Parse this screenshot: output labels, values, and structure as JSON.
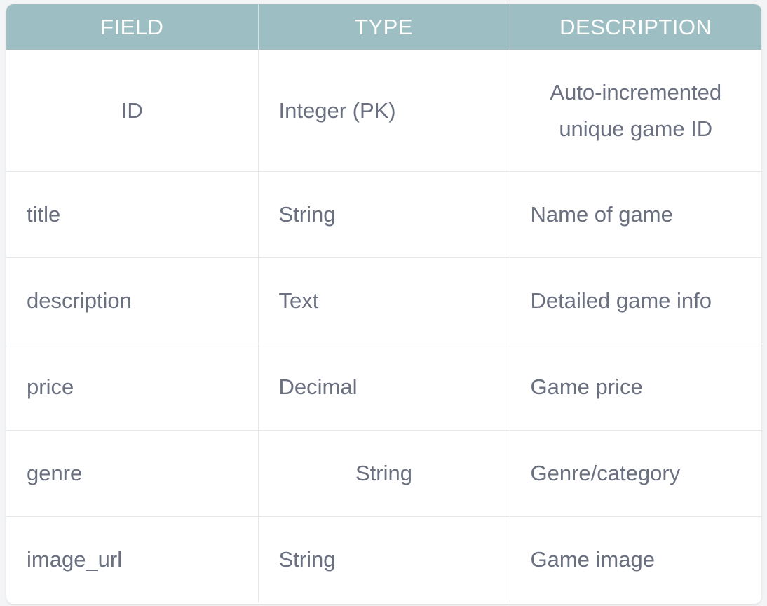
{
  "table": {
    "headers": [
      "FIELD",
      "TYPE",
      "DESCRIPTION"
    ],
    "rows": [
      {
        "field": "ID",
        "type": "Integer (PK)",
        "description": "Auto-incremented unique game ID"
      },
      {
        "field": "title",
        "type": "String",
        "description": "Name of game"
      },
      {
        "field": "description",
        "type": "Text",
        "description": "Detailed game info"
      },
      {
        "field": "price",
        "type": "Decimal",
        "description": "Game price"
      },
      {
        "field": "genre",
        "type": "String",
        "description": "Genre/category"
      },
      {
        "field": "image_url",
        "type": "String",
        "description": "Game image"
      }
    ]
  },
  "colors": {
    "header_bg": "#9dbfc3",
    "header_text": "#ffffff",
    "cell_text": "#6b7080",
    "border": "#e5e7eb"
  }
}
